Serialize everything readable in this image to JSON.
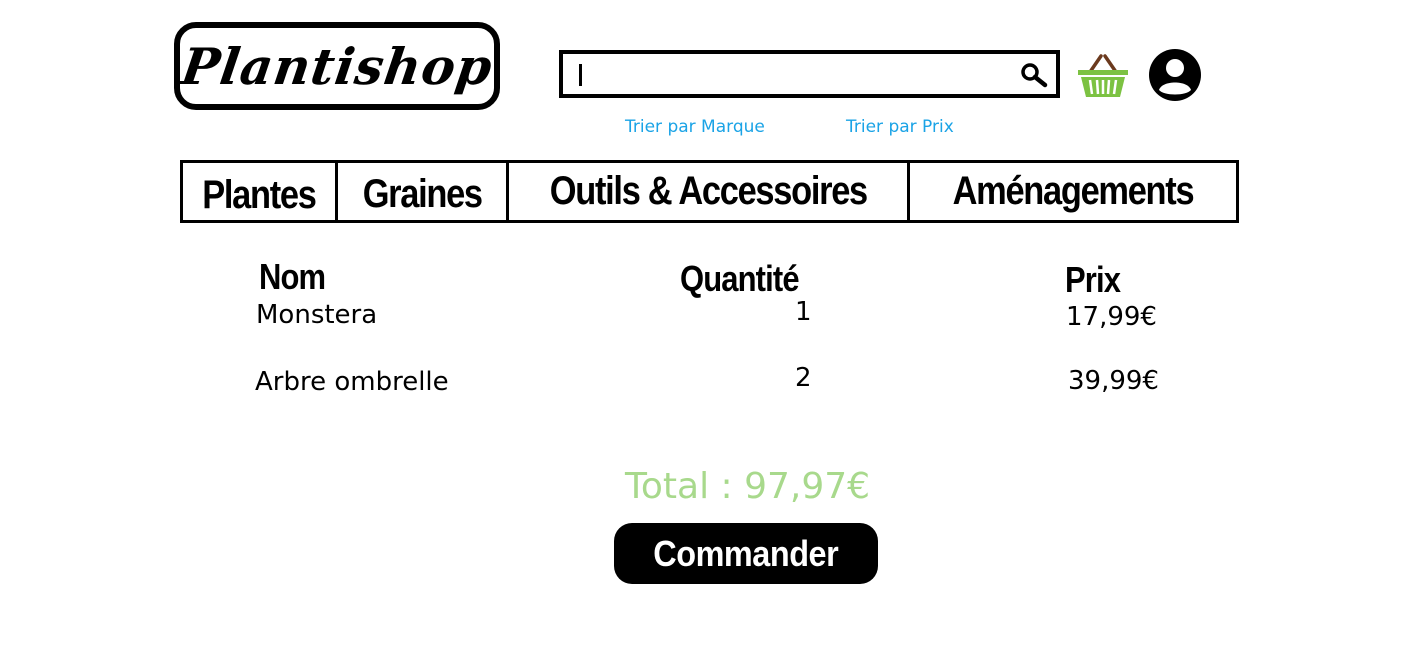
{
  "header": {
    "logo_text": "Plantishop",
    "search": {
      "value": "",
      "placeholder": ""
    },
    "icons": {
      "search": "search-icon",
      "basket": "basket-icon",
      "account": "account-icon"
    },
    "sort_links": {
      "brand": "Trier par Marque",
      "price": "Trier par Prix"
    }
  },
  "categories": [
    {
      "label": "Plantes"
    },
    {
      "label": "Graines"
    },
    {
      "label": "Outils & Accessoires"
    },
    {
      "label": "Aménagements"
    }
  ],
  "cart": {
    "headers": {
      "name": "Nom",
      "quantity": "Quantité",
      "price": "Prix"
    },
    "rows": [
      {
        "name": "Monstera",
        "quantity": "1",
        "price": "17,99€"
      },
      {
        "name": "Arbre ombrelle",
        "quantity": "2",
        "price": "39,99€"
      }
    ],
    "total": "Total : 97,97€",
    "order_button": "Commander"
  },
  "colors": {
    "link": "#1aa3e6",
    "total": "#a8d98c",
    "basket_green": "#7cc242",
    "basket_handle": "#6b3a1e"
  }
}
